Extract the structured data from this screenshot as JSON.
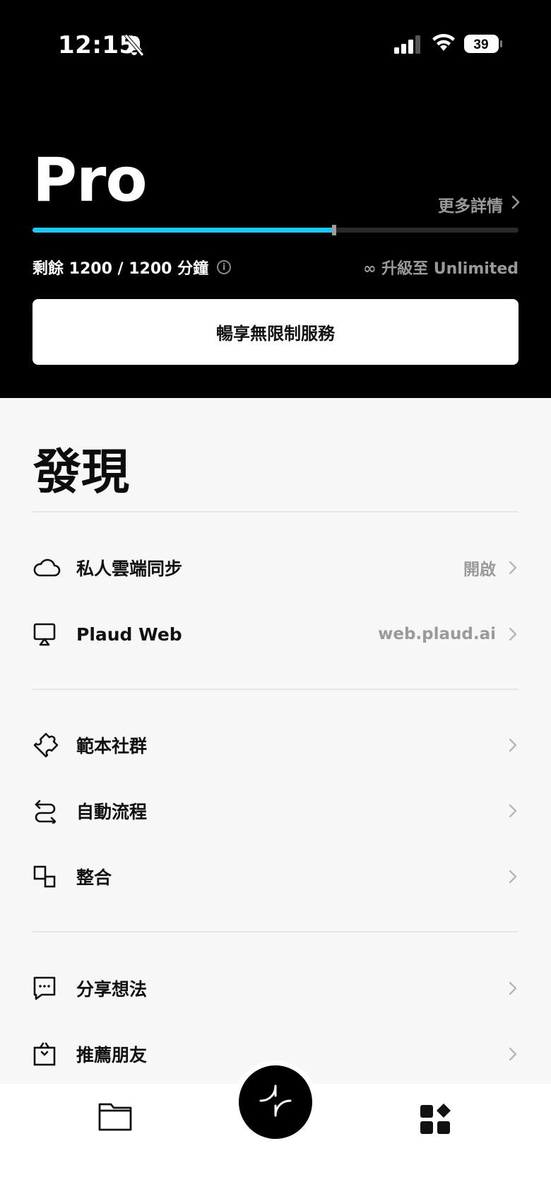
{
  "status_bar": {
    "time": "12:15",
    "battery": "39"
  },
  "plan": {
    "title": "Pro",
    "more_details": "更多詳情",
    "progress_fraction": 0.62,
    "remaining": "剩餘 1200 / 1200 分鐘",
    "upgrade": "∞ 升級至 Unlimited",
    "cta": "暢享無限制服務"
  },
  "discover": {
    "title": "發現",
    "sections": [
      [
        {
          "label": "私人雲端同步",
          "value": "開啟",
          "icon": "cloud-icon"
        },
        {
          "label": "Plaud Web",
          "value": "web.plaud.ai",
          "icon": "monitor-icon"
        }
      ],
      [
        {
          "label": "範本社群",
          "value": "",
          "icon": "puzzle-icon"
        },
        {
          "label": "自動流程",
          "value": "",
          "icon": "workflow-icon"
        },
        {
          "label": "整合",
          "value": "",
          "icon": "integration-icon"
        }
      ],
      [
        {
          "label": "分享想法",
          "value": "",
          "icon": "chat-bubble-icon"
        },
        {
          "label": "推薦朋友",
          "value": "",
          "icon": "gift-icon"
        }
      ]
    ]
  },
  "tab_bar": {
    "items": [
      "folder-icon",
      "record-icon",
      "apps-grid-icon"
    ]
  },
  "colors": {
    "accent": "#1ec8f2",
    "header_bg": "#000000",
    "muted": "#9a9a9a"
  }
}
